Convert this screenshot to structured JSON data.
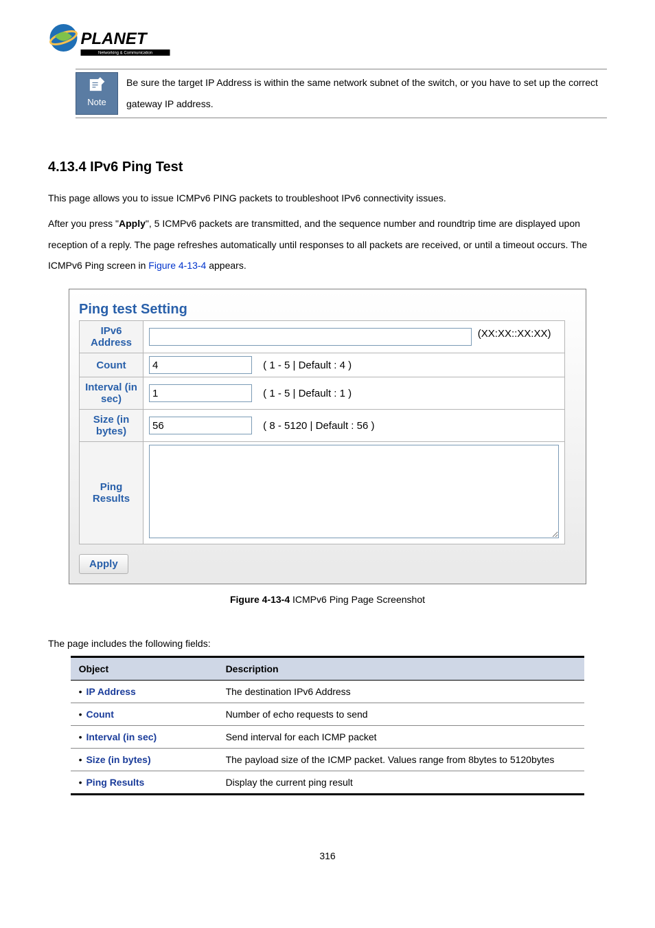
{
  "logo": {
    "brand": "PLANET",
    "tagline": "Networking & Communication"
  },
  "note": {
    "label": "Note",
    "text": "Be sure the target IP Address is within the same network subnet of the switch, or you have to set up the correct gateway IP address."
  },
  "section_heading": "4.13.4 IPv6 Ping Test",
  "intro_paragraph_1": "This page allows you to issue ICMPv6 PING packets to troubleshoot IPv6 connectivity issues.",
  "intro_paragraph_2a": "After you press \"",
  "intro_paragraph_2_bold": "Apply",
  "intro_paragraph_2b": "\", 5 ICMPv6 packets are transmitted, and the sequence number and roundtrip time are displayed upon reception of a reply. The page refreshes automatically until responses to all packets are received, or until a timeout occurs. The ICMPv6 Ping screen in ",
  "intro_paragraph_2_link": "Figure 4-13-4",
  "intro_paragraph_2c": " appears.",
  "screenshot": {
    "title": "Ping test Setting",
    "rows": {
      "ipv6_address": {
        "label": "IPv6 Address",
        "value": "",
        "hint": "(XX:XX::XX:XX)"
      },
      "count": {
        "label": "Count",
        "value": "4",
        "hint": "( 1 - 5 | Default : 4 )"
      },
      "interval": {
        "label": "Interval (in sec)",
        "value": "1",
        "hint": "( 1 - 5 | Default : 1 )"
      },
      "size": {
        "label": "Size (in bytes)",
        "value": "56",
        "hint": "( 8 - 5120 | Default : 56 )"
      },
      "results": {
        "label": "Ping Results",
        "value": ""
      }
    },
    "apply": "Apply"
  },
  "figure_caption_bold": "Figure 4-13-4",
  "figure_caption_rest": " ICMPv6 Ping Page Screenshot",
  "fields_intro": "The page includes the following fields:",
  "fields_table": {
    "headers": {
      "object": "Object",
      "description": "Description"
    },
    "rows": [
      {
        "object": "IP Address",
        "description": "The destination IPv6 Address"
      },
      {
        "object": "Count",
        "description": "Number of echo requests to send"
      },
      {
        "object": "Interval (in sec)",
        "description": "Send interval for each ICMP packet"
      },
      {
        "object": "Size (in bytes)",
        "description": "The payload size of the ICMP packet. Values range from 8bytes to 5120bytes"
      },
      {
        "object": "Ping Results",
        "description": "Display the current ping result"
      }
    ]
  },
  "page_number": "316"
}
